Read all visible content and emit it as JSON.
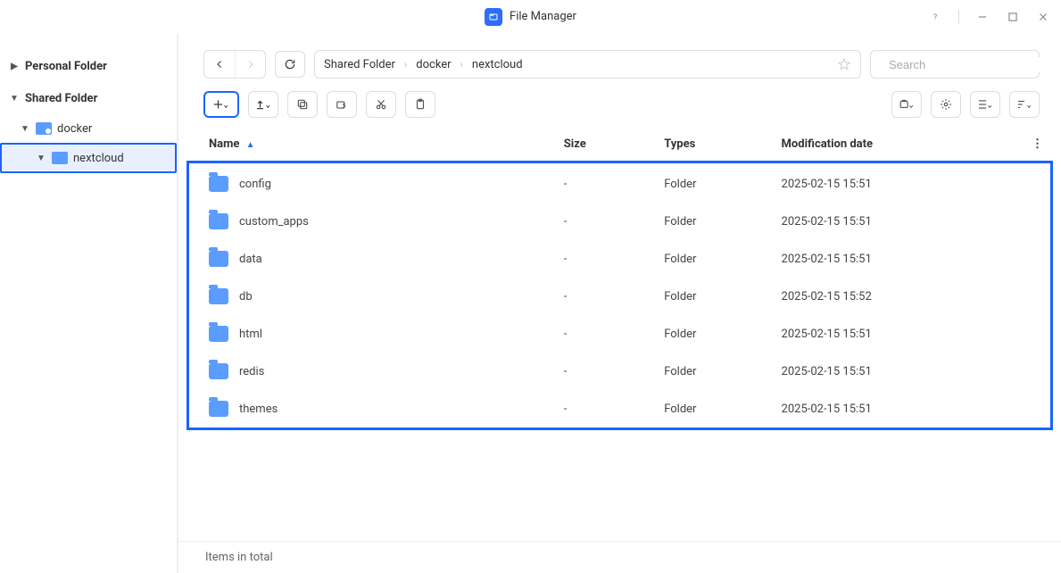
{
  "app": {
    "title": "File Manager"
  },
  "sidebar": {
    "personal": "Personal Folder",
    "shared": "Shared Folder",
    "docker": "docker",
    "nextcloud": "nextcloud"
  },
  "breadcrumb": {
    "parts": [
      "Shared Folder",
      "docker",
      "nextcloud"
    ]
  },
  "search": {
    "placeholder": "Search"
  },
  "columns": {
    "name": "Name",
    "size": "Size",
    "types": "Types",
    "modified": "Modification date"
  },
  "rows": [
    {
      "name": "config",
      "size": "-",
      "type": "Folder",
      "modified": "2025-02-15 15:51"
    },
    {
      "name": "custom_apps",
      "size": "-",
      "type": "Folder",
      "modified": "2025-02-15 15:51"
    },
    {
      "name": "data",
      "size": "-",
      "type": "Folder",
      "modified": "2025-02-15 15:51"
    },
    {
      "name": "db",
      "size": "-",
      "type": "Folder",
      "modified": "2025-02-15 15:52"
    },
    {
      "name": "html",
      "size": "-",
      "type": "Folder",
      "modified": "2025-02-15 15:51"
    },
    {
      "name": "redis",
      "size": "-",
      "type": "Folder",
      "modified": "2025-02-15 15:51"
    },
    {
      "name": "themes",
      "size": "-",
      "type": "Folder",
      "modified": "2025-02-15 15:51"
    }
  ],
  "status": {
    "text": "Items in total"
  }
}
